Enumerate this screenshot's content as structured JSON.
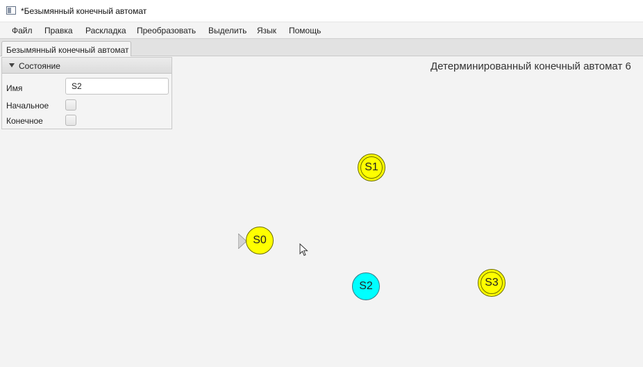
{
  "window": {
    "title": "*Безымянный конечный автомат"
  },
  "menu": {
    "items": [
      "Файл",
      "Правка",
      "Раскладка",
      "Преобразовать",
      "Выделить",
      "Язык",
      "Помощь"
    ]
  },
  "tabs": [
    {
      "label": "Безымянный конечный автомат"
    }
  ],
  "canvas": {
    "machine_type": "Детерминированный конечный автомат 6"
  },
  "properties_panel": {
    "title": "Состояние",
    "name_label": "Имя",
    "name_value": "S2",
    "initial_label": "Начальное",
    "initial_checked": false,
    "final_label": "Конечное",
    "final_checked": false
  },
  "colors": {
    "state_fill": "#ffff00",
    "selected_state_fill": "#00ffff"
  },
  "states": [
    {
      "label": "S0",
      "initial": true,
      "accepting": false,
      "selected": false
    },
    {
      "label": "S1",
      "initial": false,
      "accepting": true,
      "selected": false
    },
    {
      "label": "S2",
      "initial": false,
      "accepting": false,
      "selected": true
    },
    {
      "label": "S3",
      "initial": false,
      "accepting": true,
      "selected": false
    }
  ]
}
